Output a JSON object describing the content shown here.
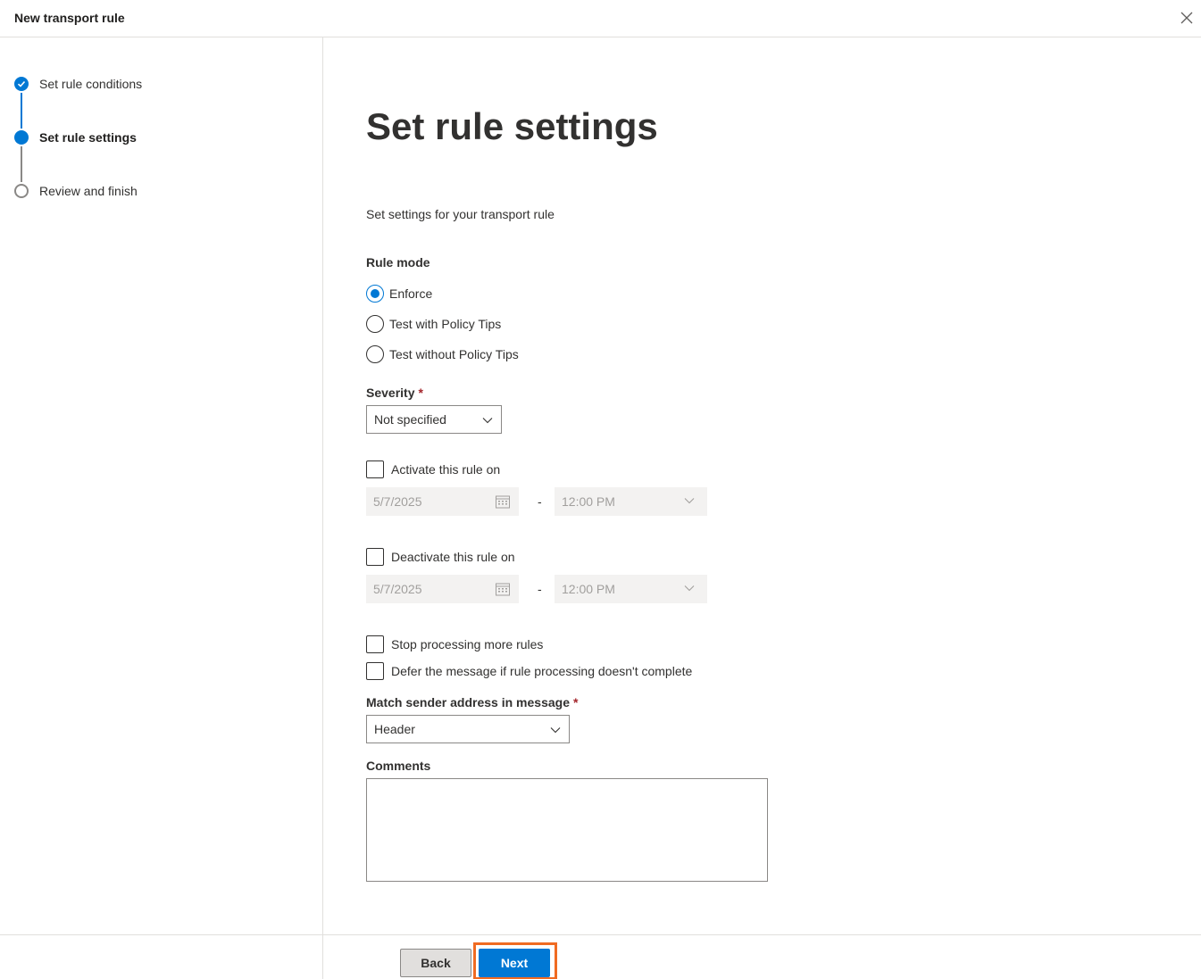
{
  "window": {
    "title": "New transport rule",
    "close_icon": "close-icon"
  },
  "steps": [
    {
      "label": "Set rule conditions",
      "state": "completed"
    },
    {
      "label": "Set rule settings",
      "state": "current"
    },
    {
      "label": "Review and finish",
      "state": "pending"
    }
  ],
  "main": {
    "heading": "Set rule settings",
    "description": "Set settings for your transport rule",
    "rule_mode": {
      "label": "Rule mode",
      "options": [
        "Enforce",
        "Test with Policy Tips",
        "Test without Policy Tips"
      ],
      "selected": "Enforce"
    },
    "severity": {
      "label": "Severity",
      "required_mark": "*",
      "value": "Not specified"
    },
    "activate": {
      "label": "Activate this rule on",
      "checked": false,
      "date": "5/7/2025",
      "time": "12:00 PM",
      "separator": "-"
    },
    "deactivate": {
      "label": "Deactivate this rule on",
      "checked": false,
      "date": "5/7/2025",
      "time": "12:00 PM",
      "separator": "-"
    },
    "stop_processing": {
      "label": "Stop processing more rules",
      "checked": false
    },
    "defer": {
      "label": "Defer the message if rule processing doesn't complete",
      "checked": false
    },
    "match_sender": {
      "label": "Match sender address in message",
      "required_mark": "*",
      "value": "Header"
    },
    "comments": {
      "label": "Comments",
      "value": ""
    }
  },
  "footer": {
    "back_label": "Back",
    "next_label": "Next"
  },
  "colors": {
    "accent": "#0078d4",
    "highlight": "#f06b22",
    "required": "#a4262c"
  }
}
